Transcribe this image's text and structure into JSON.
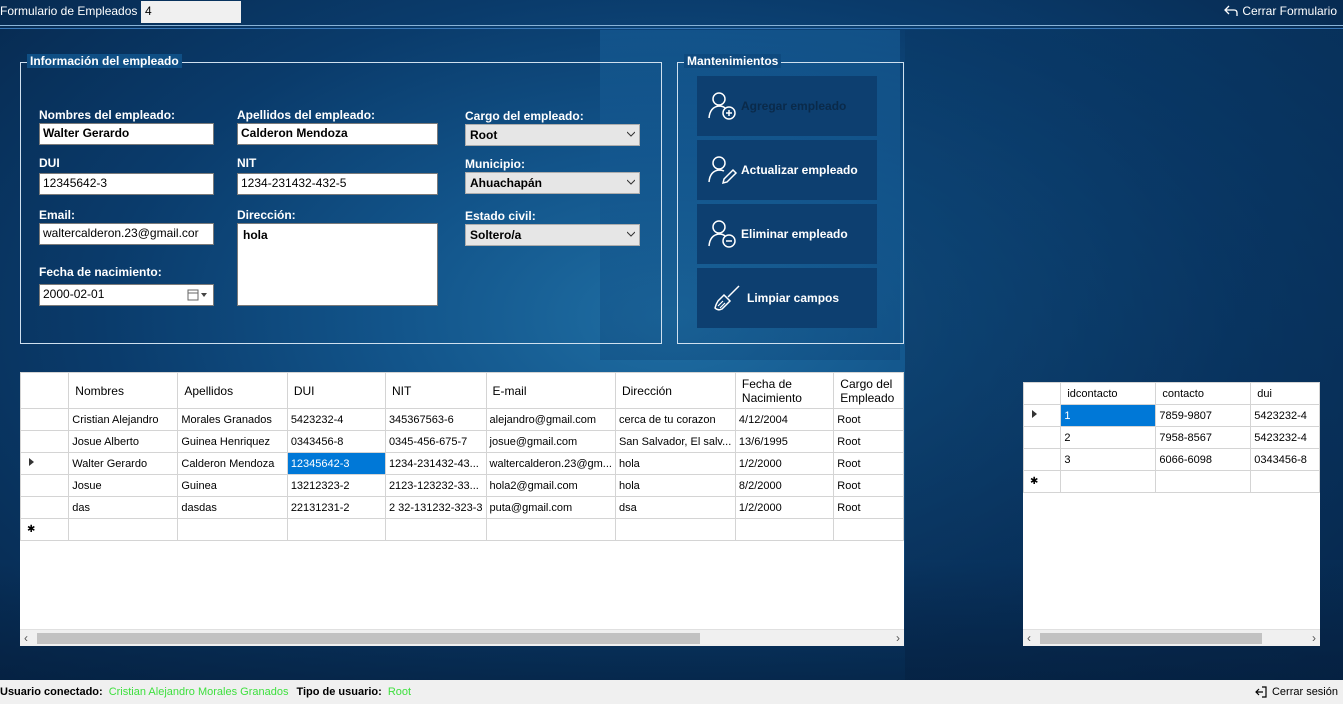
{
  "window": {
    "title": "Formulario de Empleados",
    "tab_value": "4",
    "close_form": "Cerrar Formulario"
  },
  "info": {
    "legend": "Información del empleado",
    "nombres_label": "Nombres del empleado:",
    "nombres_value": "Walter Gerardo",
    "apellidos_label": "Apellidos del empleado:",
    "apellidos_value": "Calderon Mendoza",
    "cargo_label": "Cargo del empleado:",
    "cargo_value": "Root",
    "dui_label": "DUI",
    "dui_value": "12345642-3",
    "nit_label": "NIT",
    "nit_value": "1234-231432-432-5",
    "municipio_label": "Municipio:",
    "municipio_value": "Ahuachapán",
    "email_label": "Email:",
    "email_value": "waltercalderon.23@gmail.cor",
    "direccion_label": "Dirección:",
    "direccion_value": "hola",
    "estado_label": "Estado civil:",
    "estado_value": "Soltero/a",
    "fecha_label": "Fecha de nacimiento:",
    "fecha_value": "2000-02-01"
  },
  "maint": {
    "legend": "Mantenimientos",
    "add": "Agregar empleado",
    "update": "Actualizar empleado",
    "delete": "Eliminar empleado",
    "clear": "Limpiar campos"
  },
  "employees": {
    "headers": [
      "Nombres",
      "Apellidos",
      "DUI",
      "NIT",
      "E-mail",
      "Dirección",
      "Fecha de Nacimiento",
      "Cargo del Empleado"
    ],
    "rows": [
      [
        "Cristian Alejandro",
        "Morales Granados",
        "5423232-4",
        "345367563-6",
        "alejandro@gmail.com",
        "cerca de tu corazon",
        "4/12/2004",
        "Root"
      ],
      [
        "Josue Alberto",
        "Guinea Henriquez",
        "0343456-8",
        "0345-456-675-7",
        "josue@gmail.com",
        "San Salvador, El salv...",
        "13/6/1995",
        "Root"
      ],
      [
        "Walter Gerardo",
        "Calderon Mendoza",
        "12345642-3",
        "1234-231432-43...",
        "waltercalderon.23@gm...",
        "hola",
        "1/2/2000",
        "Root"
      ],
      [
        "Josue",
        "Guinea",
        "13212323-2",
        "2123-123232-33...",
        "hola2@gmail.com",
        "hola",
        "8/2/2000",
        "Root"
      ],
      [
        "das",
        "dasdas",
        "22131231-2",
        "2 32-131232-323-3",
        "puta@gmail.com",
        "dsa",
        "1/2/2000",
        "Root"
      ]
    ]
  },
  "contacts": {
    "headers": [
      "idcontacto",
      "contacto",
      "dui"
    ],
    "rows": [
      [
        "1",
        "7859-9807",
        "5423232-4"
      ],
      [
        "2",
        "7958-8567",
        "5423232-4"
      ],
      [
        "3",
        "6066-6098",
        "0343456-8"
      ]
    ]
  },
  "status": {
    "user_label": "Usuario conectado:",
    "user_value": "Cristian Alejandro Morales Granados",
    "type_label": "Tipo de usuario:",
    "type_value": "Root",
    "logout": "Cerrar sesión"
  },
  "colors": {
    "accent": "#0078d7",
    "status_green": "#3fe03f",
    "button_bg": "#0d3f70"
  }
}
